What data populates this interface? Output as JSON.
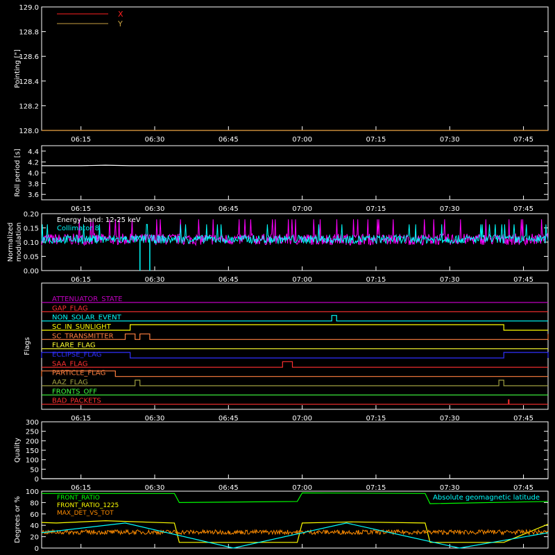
{
  "chart_data": [
    {
      "type": "line",
      "ylabel": "Pointing [\"]",
      "ylim": [
        128.0,
        129.0
      ],
      "yticks": [
        "129.0",
        "128.8",
        "128.6",
        "128.4",
        "128.2",
        "128.0"
      ],
      "xticks": [
        "06:15",
        "06:30",
        "06:45",
        "07:00",
        "07:15",
        "07:30",
        "07:45"
      ],
      "legend": [
        {
          "name": "X",
          "color": "#ff2020"
        },
        {
          "name": "Y",
          "color": "#c8a040"
        }
      ],
      "series": [
        {
          "name": "X",
          "color": "#ff2020",
          "x": [
            "06:07",
            "07:50"
          ],
          "values": [
            128.0,
            128.0
          ]
        },
        {
          "name": "Y",
          "color": "#c8a040",
          "x": [
            "06:07",
            "07:50"
          ],
          "values": [
            128.0,
            128.0
          ]
        }
      ]
    },
    {
      "type": "line",
      "ylabel": "Roll period [s]",
      "ylim": [
        3.5,
        4.5
      ],
      "yticks": [
        "4.4",
        "4.2",
        "4.0",
        "3.8",
        "3.6"
      ],
      "xticks": [
        "06:15",
        "06:30",
        "06:45",
        "07:00",
        "07:15",
        "07:30",
        "07:45"
      ],
      "series": [
        {
          "name": "roll",
          "color": "#ffffff",
          "x": [
            "06:07",
            "06:15",
            "06:20",
            "06:25",
            "07:50"
          ],
          "values": [
            4.13,
            4.13,
            4.14,
            4.13,
            4.13
          ]
        }
      ]
    },
    {
      "type": "line",
      "ylabel": "Normalized modulation",
      "ylim": [
        0.0,
        0.2
      ],
      "yticks": [
        "0.20",
        "0.15",
        "0.10",
        "0.05",
        "0.00"
      ],
      "xticks": [
        "06:15",
        "06:30",
        "06:45",
        "07:00",
        "07:15",
        "07:30",
        "07:45"
      ],
      "annotations": [
        "Energy band: 12-25 keV",
        "Collimator 8"
      ],
      "series": [
        {
          "name": "magenta",
          "color": "#ff00ff",
          "mean": 0.11,
          "spread": 0.02
        },
        {
          "name": "Collimator 8",
          "color": "#00ffff",
          "mean": 0.11,
          "spread": 0.015,
          "dropouts": [
            "06:27",
            "06:29"
          ]
        }
      ]
    },
    {
      "type": "line",
      "ylabel": "Flags",
      "xticks": [
        "06:15",
        "06:30",
        "06:45",
        "07:00",
        "07:15",
        "07:30",
        "07:45"
      ],
      "flags": [
        {
          "label": "ATTENUATOR_STATE",
          "color": "#c000c0",
          "segments": []
        },
        {
          "label": "GAP_FLAG",
          "color": "#ff3030",
          "segments": []
        },
        {
          "label": "NON_SOLAR_EVENT",
          "color": "#00ffff",
          "segments": [
            [
              "07:06",
              "07:07"
            ]
          ]
        },
        {
          "label": "SC_IN_SUNLIGHT",
          "color": "#ffff00",
          "segments": [
            [
              "06:25",
              "07:41"
            ]
          ]
        },
        {
          "label": "SC_TRANSMITTER",
          "color": "#ff8040",
          "segments": [
            [
              "06:24",
              "06:26"
            ],
            [
              "06:27",
              "06:29"
            ],
            [
              "07:50",
              "07:51"
            ]
          ]
        },
        {
          "label": "FLARE_FLAG",
          "color": "#ffff30",
          "segments": []
        },
        {
          "label": "ECLIPSE_FLAG",
          "color": "#3030ff",
          "segments": [
            [
              "06:07",
              "06:25"
            ],
            [
              "07:41",
              "07:51"
            ]
          ]
        },
        {
          "label": "SAA_FLAG",
          "color": "#ff3030",
          "segments": [
            [
              "06:56",
              "06:58"
            ]
          ]
        },
        {
          "label": "PARTICLE_FLAG",
          "color": "#ff8040",
          "segments": [
            [
              "06:07",
              "06:22"
            ]
          ]
        },
        {
          "label": "AAZ_FLAG",
          "color": "#a0a040",
          "segments": [
            [
              "06:26",
              "06:27"
            ],
            [
              "07:40",
              "07:41"
            ]
          ]
        },
        {
          "label": "FRONTS_OFF",
          "color": "#40ff40",
          "segments": []
        },
        {
          "label": "BAD_PACKETS",
          "color": "#ff3030",
          "segments": [],
          "spikes": [
            "07:42"
          ]
        }
      ]
    },
    {
      "type": "line",
      "ylabel": "Quality",
      "ylim": [
        0,
        300
      ],
      "yticks": [
        "300",
        "250",
        "200",
        "150",
        "100",
        "50",
        "0"
      ],
      "xticks": [
        "06:15",
        "06:30",
        "06:45",
        "07:00",
        "07:15",
        "07:30",
        "07:45"
      ],
      "series": [
        {
          "name": "quality",
          "color": "#ffffff",
          "x": [
            "06:07",
            "07:50"
          ],
          "values": [
            0,
            0
          ]
        }
      ]
    },
    {
      "type": "line",
      "ylabel": "Degrees or %",
      "ylim": [
        0,
        100
      ],
      "yticks": [
        "100",
        "80",
        "60",
        "40",
        "20",
        "0"
      ],
      "xticks": [],
      "legend": [
        {
          "name": "FRONT_RATIO",
          "color": "#00ff00"
        },
        {
          "name": "FRONT_RATIO_1225",
          "color": "#ffff00"
        },
        {
          "name": "MAX_DET_VS_TOT",
          "color": "#ff8c00"
        },
        {
          "name": "Absolute geomagnetic latitude",
          "color": "#00ffff"
        }
      ],
      "series": [
        {
          "name": "FRONT_RATIO",
          "color": "#00ff00",
          "x": [
            "06:07",
            "06:34",
            "06:35",
            "06:59",
            "07:00",
            "07:25",
            "07:26",
            "07:50"
          ],
          "values": [
            96,
            96,
            80,
            82,
            97,
            96,
            78,
            82
          ]
        },
        {
          "name": "FRONT_RATIO_1225",
          "color": "#ffff00",
          "x": [
            "06:07",
            "06:10",
            "06:20",
            "06:34",
            "06:35",
            "06:59",
            "07:00",
            "07:10",
            "07:25",
            "07:26",
            "07:41",
            "07:50"
          ],
          "values": [
            45,
            44,
            48,
            44,
            10,
            10,
            44,
            46,
            44,
            10,
            10,
            42
          ]
        },
        {
          "name": "MAX_DET_VS_TOT",
          "color": "#ff8c00",
          "mean": 28,
          "spread": 4
        },
        {
          "name": "Absolute geomagnetic latitude",
          "color": "#00ffff",
          "x": [
            "06:07",
            "06:24",
            "06:46",
            "07:09",
            "07:32",
            "07:50"
          ],
          "values": [
            27,
            44,
            0,
            44,
            0,
            27
          ]
        }
      ]
    }
  ]
}
